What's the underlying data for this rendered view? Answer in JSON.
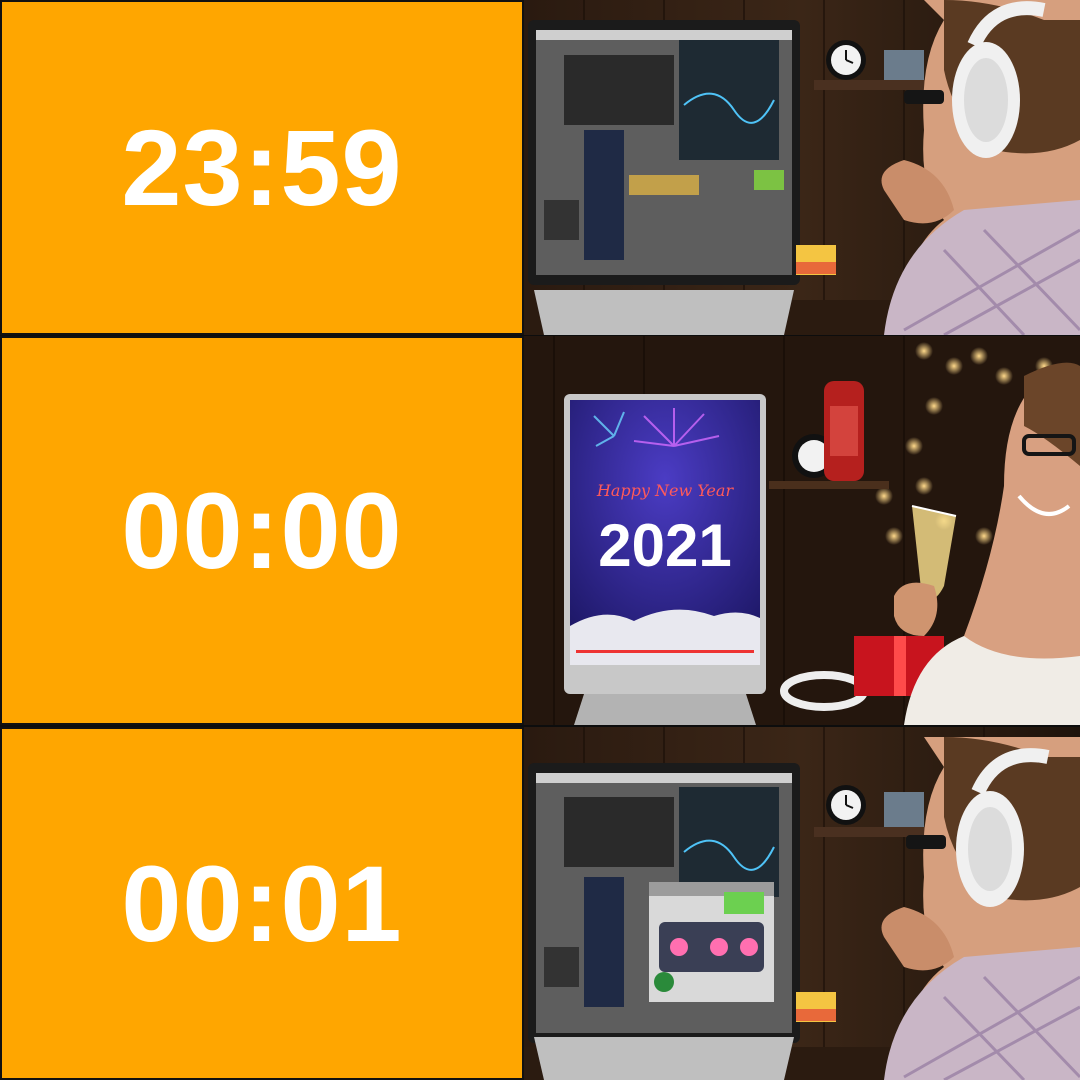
{
  "panels": [
    {
      "time": "23:59",
      "scene": "producer-at-daw"
    },
    {
      "time": "00:00",
      "scene": "celebration",
      "screen_title": "Happy New Year",
      "screen_year": "2021"
    },
    {
      "time": "00:01",
      "scene": "producer-at-daw"
    }
  ],
  "colors": {
    "panel_bg": "#ffa600",
    "panel_text": "#ffffff",
    "divider": "#111111"
  }
}
